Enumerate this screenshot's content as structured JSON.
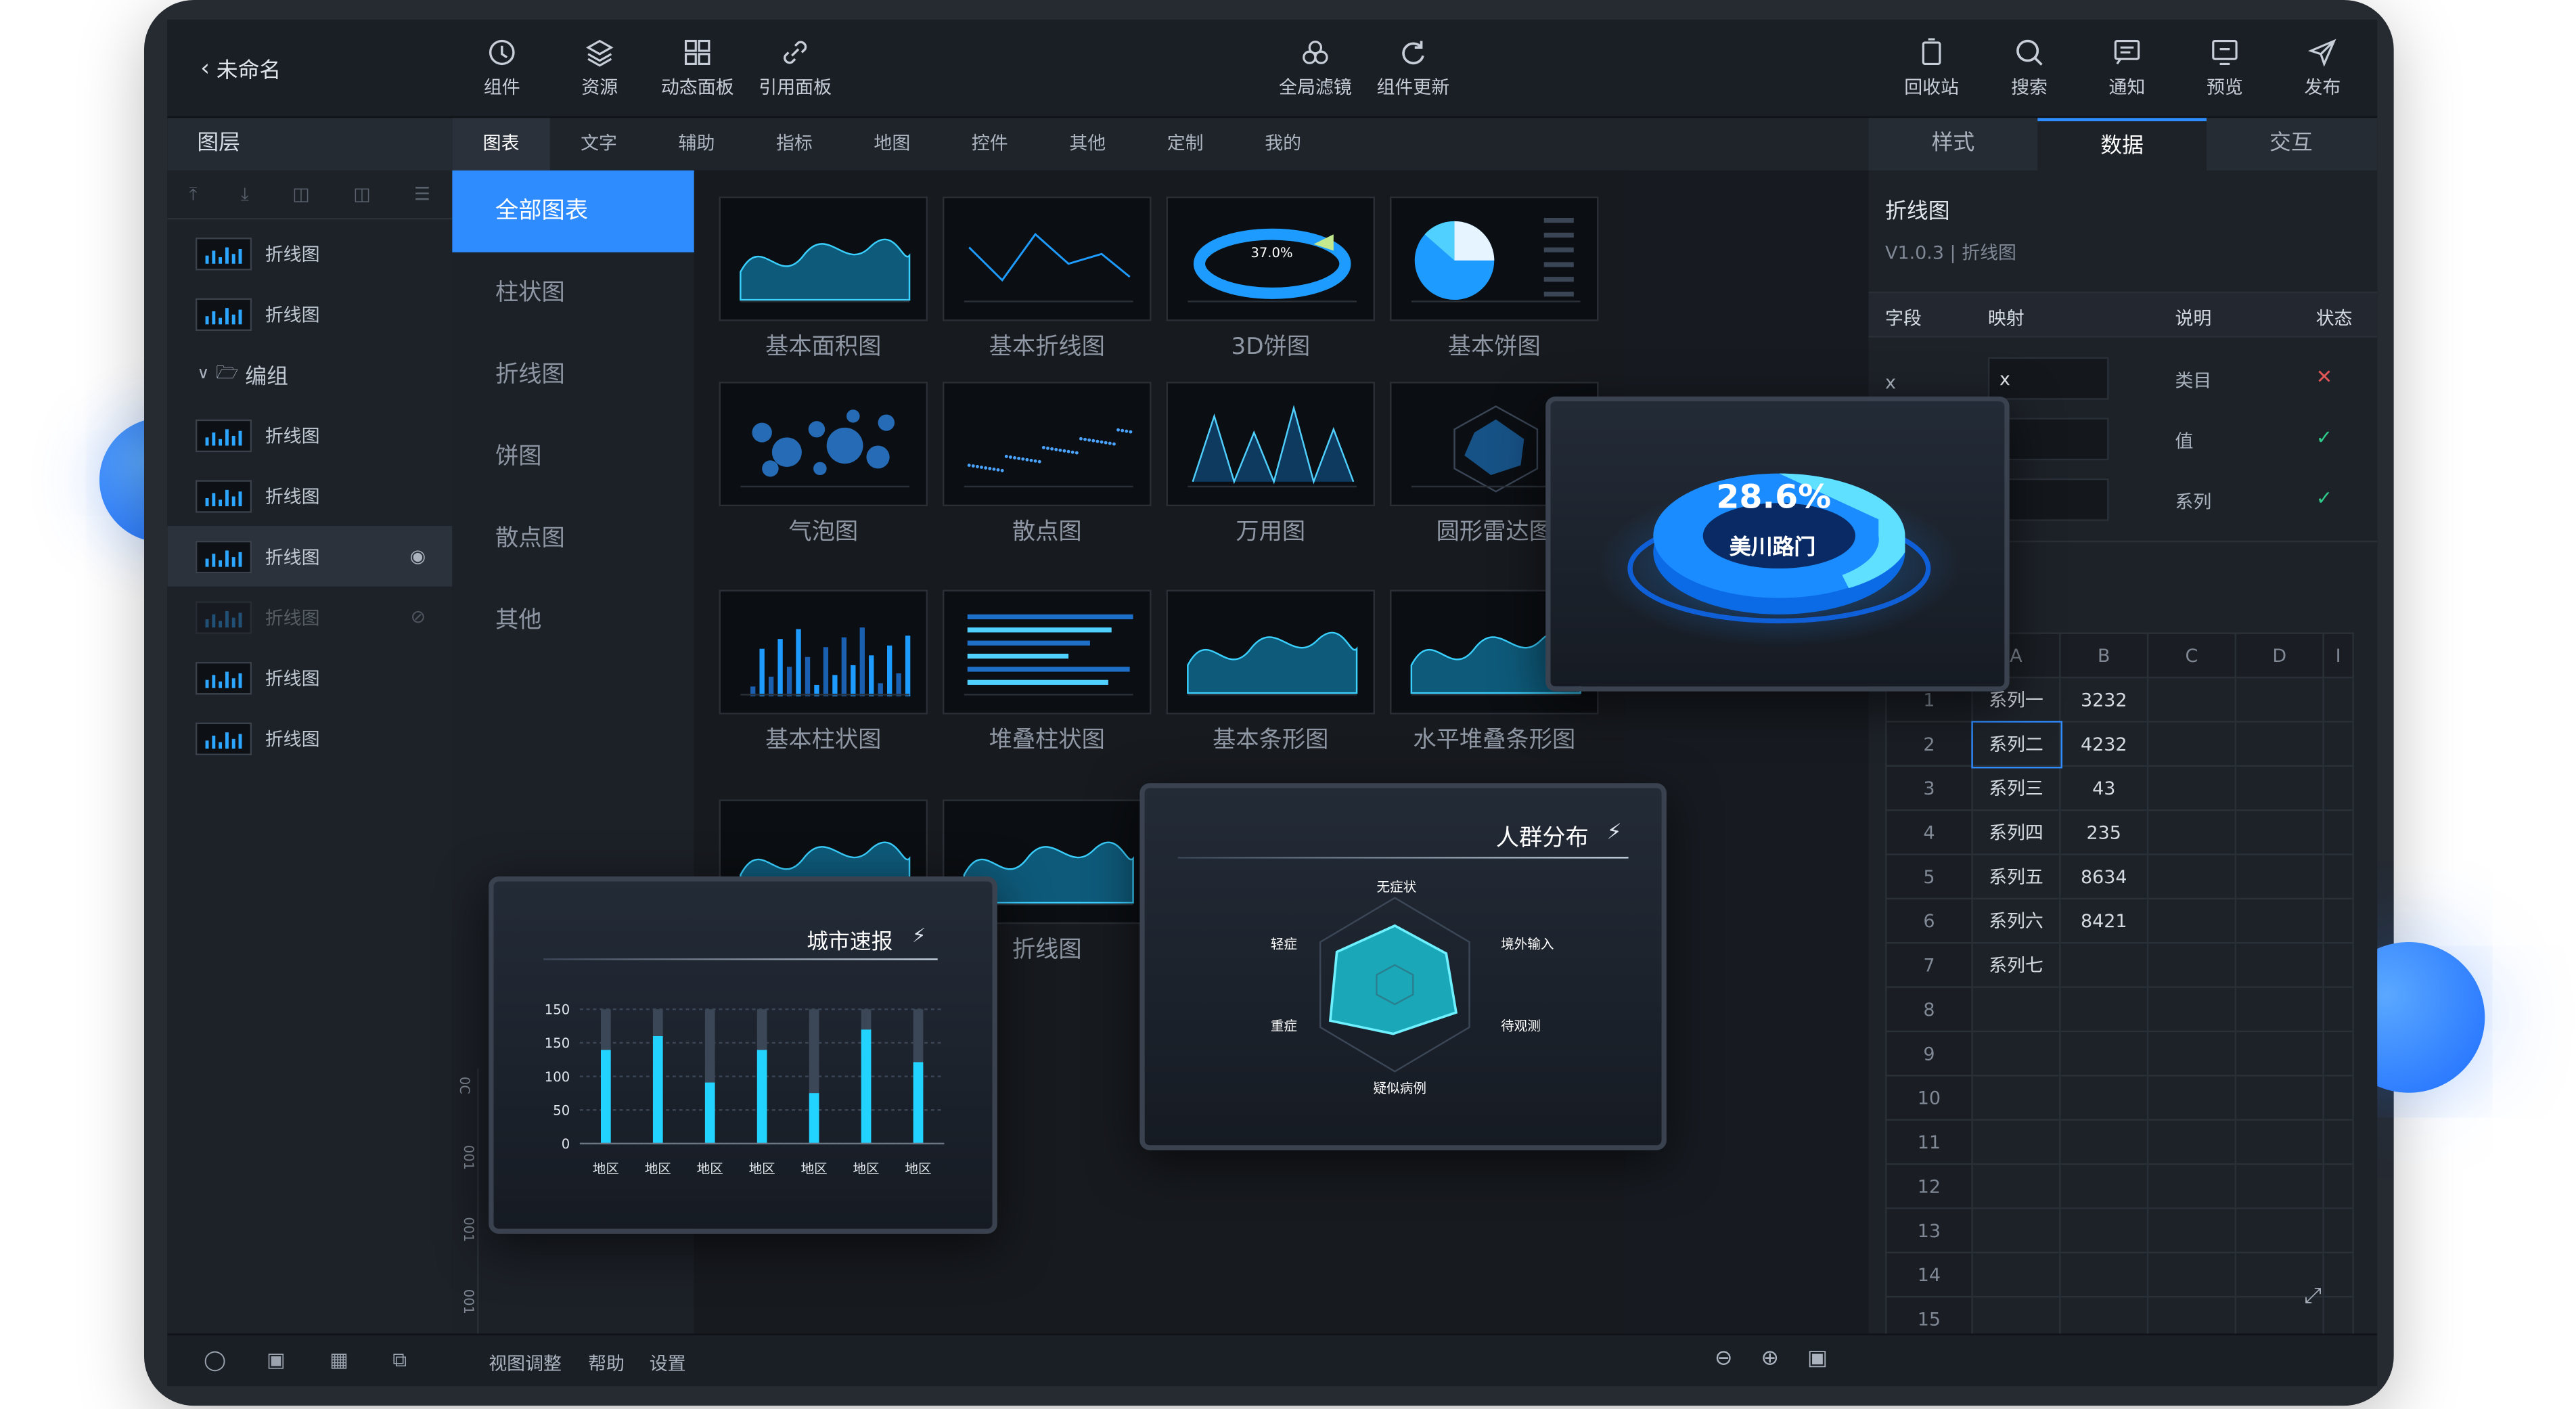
{
  "colors": {
    "accent": "#2f8cff",
    "ok": "#2ecc8a",
    "err": "#e05555",
    "frame": "#262b32"
  },
  "app": {
    "back_label": "未命名"
  },
  "toolbar": {
    "left": [
      {
        "label": "组件",
        "icon": "component-icon"
      },
      {
        "label": "资源",
        "icon": "layers-icon"
      },
      {
        "label": "动态面板",
        "icon": "dashboard-icon"
      },
      {
        "label": "引用面板",
        "icon": "link-icon"
      }
    ],
    "center": [
      {
        "label": "全局滤镜",
        "icon": "filter-icon"
      },
      {
        "label": "组件更新",
        "icon": "refresh-icon"
      }
    ],
    "right": [
      {
        "label": "回收站",
        "icon": "trash-icon"
      },
      {
        "label": "搜索",
        "icon": "search-icon"
      },
      {
        "label": "通知",
        "icon": "message-icon"
      },
      {
        "label": "预览",
        "icon": "preview-icon"
      },
      {
        "label": "发布",
        "icon": "send-icon"
      }
    ]
  },
  "layers": {
    "title": "图层",
    "items": [
      {
        "label": "折线图"
      },
      {
        "label": "折线图"
      },
      {
        "label": "编组",
        "group": true
      },
      {
        "label": "折线图"
      },
      {
        "label": "折线图"
      },
      {
        "label": "折线图",
        "selected": true
      },
      {
        "label": "折线图",
        "hidden": true
      },
      {
        "label": "折线图"
      },
      {
        "label": "折线图"
      }
    ]
  },
  "categories": [
    "图表",
    "文字",
    "辅助",
    "指标",
    "地图",
    "控件",
    "其他",
    "定制",
    "我的"
  ],
  "chart_types": [
    "全部图表",
    "柱状图",
    "折线图",
    "饼图",
    "散点图",
    "其他"
  ],
  "gallery": [
    {
      "label": "基本面积图"
    },
    {
      "label": "基本折线图"
    },
    {
      "label": "3D饼图"
    },
    {
      "label": "基本饼图"
    },
    {
      "label": "气泡图"
    },
    {
      "label": "散点图"
    },
    {
      "label": "万用图"
    },
    {
      "label": "圆形雷达图"
    },
    {
      "label": "基本柱状图"
    },
    {
      "label": "堆叠柱状图"
    },
    {
      "label": "基本条形图"
    },
    {
      "label": "水平堆叠条形图"
    },
    {
      "label": ""
    },
    {
      "label": "折线图"
    }
  ],
  "pie3d_label": "37.0%",
  "donut_popup": {
    "value": "28.6%",
    "label": "美川路门"
  },
  "city_popup": {
    "title": "城市速报"
  },
  "radar_popup": {
    "title": "人群分布",
    "axes": [
      "无症状",
      "境外输入",
      "待观测",
      "疑似病例",
      "重症",
      "轻症"
    ]
  },
  "ruler": [
    "0C",
    "001",
    "001",
    "001"
  ],
  "right_panel": {
    "tabs": [
      "样式",
      "数据",
      "交互"
    ],
    "component_name": "折线图",
    "version": "V1.0.3 | 折线图",
    "field_headers": [
      "字段",
      "映射",
      "说明",
      "状态"
    ],
    "fields": [
      {
        "field": "x",
        "map": "x",
        "desc": "类目",
        "ok": false
      },
      {
        "field": "",
        "map": "",
        "desc": "值",
        "ok": true
      },
      {
        "field": "",
        "map": "",
        "desc": "系列",
        "ok": true
      }
    ],
    "sheet": {
      "columns": [
        "A",
        "B",
        "C",
        "D",
        "I"
      ],
      "rows": [
        {
          "n": "1",
          "a": "系列一",
          "b": "3232"
        },
        {
          "n": "2",
          "a": "系列二",
          "b": "4232"
        },
        {
          "n": "3",
          "a": "系列三",
          "b": "43"
        },
        {
          "n": "4",
          "a": "系列四",
          "b": "235"
        },
        {
          "n": "5",
          "a": "系列五",
          "b": "8634"
        },
        {
          "n": "6",
          "a": "系列六",
          "b": "8421"
        },
        {
          "n": "7",
          "a": "系列七",
          "b": ""
        },
        {
          "n": "8",
          "a": "",
          "b": ""
        },
        {
          "n": "9",
          "a": "",
          "b": ""
        },
        {
          "n": "10",
          "a": "",
          "b": ""
        },
        {
          "n": "11",
          "a": "",
          "b": ""
        },
        {
          "n": "12",
          "a": "",
          "b": ""
        },
        {
          "n": "13",
          "a": "",
          "b": ""
        },
        {
          "n": "14",
          "a": "",
          "b": ""
        },
        {
          "n": "15",
          "a": "",
          "b": ""
        }
      ]
    }
  },
  "bottom": {
    "view_adjust": "视图调整",
    "help": "帮助",
    "settings": "设置"
  },
  "chart_data": {
    "type": "bar",
    "title": "城市速报",
    "categories": [
      "地区",
      "地区",
      "地区",
      "地区",
      "地区",
      "地区",
      "地区"
    ],
    "values": [
      115,
      132,
      75,
      115,
      62,
      140,
      100
    ],
    "background_values": [
      165,
      165,
      165,
      165,
      165,
      165,
      165
    ],
    "y_ticks": [
      "0",
      "50",
      "100",
      "150",
      "150"
    ],
    "ylim": [
      0,
      165
    ]
  }
}
